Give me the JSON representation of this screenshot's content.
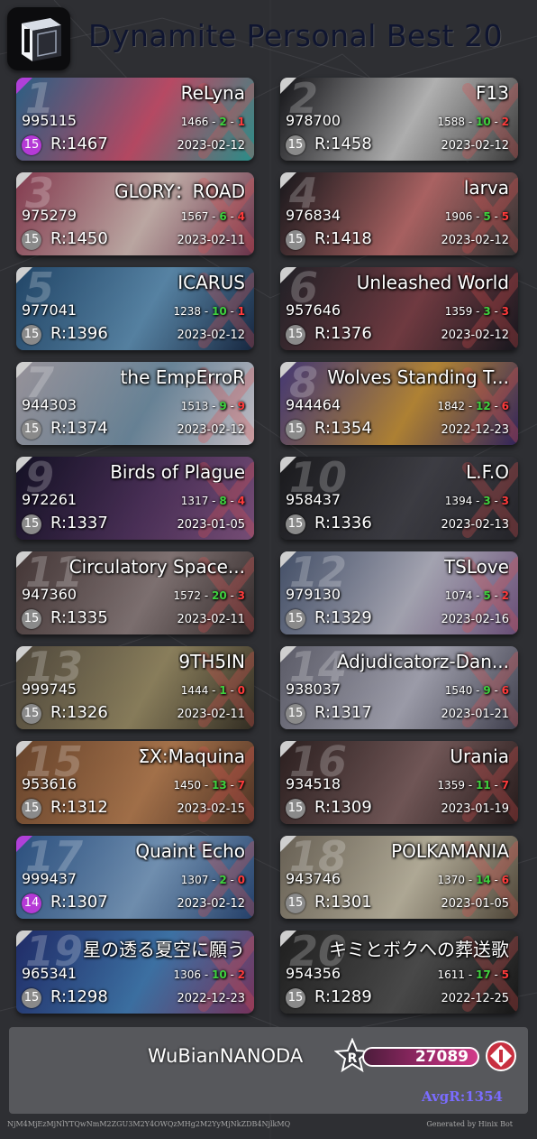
{
  "header": {
    "title": "Dynamite Personal Best 20",
    "logo_icon": "cube-logo-icon"
  },
  "cards": [
    {
      "rank": "1",
      "song": "ReLyna",
      "score": "995115",
      "notes": "1466",
      "good": "2",
      "miss": "1",
      "level": "15",
      "level_color": "purple",
      "rating": "R:1467",
      "date": "2023-02-12",
      "art": [
        "#3a7fb0",
        "#e05a7a",
        "#2fa6a0"
      ],
      "corner": "purple"
    },
    {
      "rank": "2",
      "song": "F13",
      "score": "978700",
      "notes": "1588",
      "good": "10",
      "miss": "2",
      "level": "15",
      "level_color": "gray",
      "rating": "R:1458",
      "date": "2023-02-12",
      "art": [
        "#1a1a1f",
        "#d8d8d8",
        "#444"
      ],
      "corner": "gray"
    },
    {
      "rank": "3",
      "song": "GLORY：ROAD",
      "score": "975279",
      "notes": "1567",
      "good": "6",
      "miss": "4",
      "level": "15",
      "level_color": "gray",
      "rating": "R:1450",
      "date": "2023-02-11",
      "art": [
        "#b04f6a",
        "#e8cfc9",
        "#7a3a55"
      ],
      "corner": "gray"
    },
    {
      "rank": "4",
      "song": "larva",
      "score": "976834",
      "notes": "1906",
      "good": "5",
      "miss": "5",
      "level": "15",
      "level_color": "gray",
      "rating": "R:1418",
      "date": "2023-02-12",
      "art": [
        "#1f1f24",
        "#d07878",
        "#3a3a3a"
      ],
      "corner": "gray"
    },
    {
      "rank": "5",
      "song": "ICARUS",
      "score": "977041",
      "notes": "1238",
      "good": "10",
      "miss": "1",
      "level": "15",
      "level_color": "gray",
      "rating": "R:1396",
      "date": "2023-02-12",
      "art": [
        "#2d5d8a",
        "#6aa0c8",
        "#1a2d4a"
      ],
      "corner": "gray"
    },
    {
      "rank": "6",
      "song": "Unleashed World",
      "score": "957646",
      "notes": "1359",
      "good": "3",
      "miss": "3",
      "level": "15",
      "level_color": "gray",
      "rating": "R:1376",
      "date": "2023-02-12",
      "art": [
        "#2b2b33",
        "#8a4850",
        "#1a1a22"
      ],
      "corner": "gray"
    },
    {
      "rank": "7",
      "song": "the EmpErroR",
      "score": "944303",
      "notes": "1513",
      "good": "9",
      "miss": "9",
      "level": "15",
      "level_color": "gray",
      "rating": "R:1374",
      "date": "2023-02-12",
      "art": [
        "#c9c3cd",
        "#7fa0b8",
        "#e3dce4"
      ],
      "corner": "gray"
    },
    {
      "rank": "8",
      "song": "Wolves Standing T...",
      "score": "944464",
      "notes": "1842",
      "good": "12",
      "miss": "6",
      "level": "15",
      "level_color": "gray",
      "rating": "R:1354",
      "date": "2022-12-23",
      "art": [
        "#5a4a9a",
        "#d8a040",
        "#3a2a6a"
      ],
      "corner": "gray"
    },
    {
      "rank": "9",
      "song": "Birds of Plague",
      "score": "972261",
      "notes": "1317",
      "good": "8",
      "miss": "4",
      "level": "15",
      "level_color": "gray",
      "rating": "R:1337",
      "date": "2023-01-05",
      "art": [
        "#1a1630",
        "#5a3a6a",
        "#8a5a8a"
      ],
      "corner": "gray"
    },
    {
      "rank": "10",
      "song": "L.F.O",
      "score": "958437",
      "notes": "1394",
      "good": "3",
      "miss": "3",
      "level": "15",
      "level_color": "gray",
      "rating": "R:1336",
      "date": "2023-02-13",
      "art": [
        "#232327",
        "#4a4a52",
        "#2a2a30"
      ],
      "corner": "gray"
    },
    {
      "rank": "11",
      "song": "Circulatory Space...",
      "score": "947360",
      "notes": "1572",
      "good": "20",
      "miss": "3",
      "level": "15",
      "level_color": "gray",
      "rating": "R:1335",
      "date": "2023-02-11",
      "art": [
        "#5a4848",
        "#9a8a8a",
        "#3a3030"
      ],
      "corner": "gray"
    },
    {
      "rank": "12",
      "song": "TSLove",
      "score": "979130",
      "notes": "1074",
      "good": "5",
      "miss": "2",
      "level": "15",
      "level_color": "gray",
      "rating": "R:1329",
      "date": "2023-02-16",
      "art": [
        "#5a6a8a",
        "#c8c8d8",
        "#7a5a8a"
      ],
      "corner": "gray"
    },
    {
      "rank": "13",
      "song": "9TH5IN",
      "score": "999745",
      "notes": "1444",
      "good": "1",
      "miss": "0",
      "level": "15",
      "level_color": "gray",
      "rating": "R:1326",
      "date": "2023-02-11",
      "art": [
        "#6a6050",
        "#a89a70",
        "#3a3428"
      ],
      "corner": "gray"
    },
    {
      "rank": "14",
      "song": "Adjudicatorz-Dan...",
      "score": "938037",
      "notes": "1540",
      "good": "9",
      "miss": "6",
      "level": "15",
      "level_color": "gray",
      "rating": "R:1317",
      "date": "2023-01-21",
      "art": [
        "#7a7a8a",
        "#c0c0d0",
        "#4a4a5a"
      ],
      "corner": "gray"
    },
    {
      "rank": "15",
      "song": "ΣX:Maquina",
      "score": "953616",
      "notes": "1450",
      "good": "13",
      "miss": "7",
      "level": "15",
      "level_color": "gray",
      "rating": "R:1312",
      "date": "2023-02-15",
      "art": [
        "#8a5a3a",
        "#c88a5a",
        "#5a3a2a"
      ],
      "corner": "gray"
    },
    {
      "rank": "16",
      "song": "Urania",
      "score": "934518",
      "notes": "1359",
      "good": "11",
      "miss": "7",
      "level": "15",
      "level_color": "gray",
      "rating": "R:1309",
      "date": "2023-01-19",
      "art": [
        "#3a2a2a",
        "#8a6a6a",
        "#2a1e1e"
      ],
      "corner": "gray"
    },
    {
      "rank": "17",
      "song": "Quaint Echo",
      "score": "999437",
      "notes": "1307",
      "good": "2",
      "miss": "0",
      "level": "14",
      "level_color": "purple",
      "rating": "R:1307",
      "date": "2023-02-12",
      "art": [
        "#3a6aa8",
        "#8ab0d8",
        "#2a4a7a"
      ],
      "corner": "purple"
    },
    {
      "rank": "18",
      "song": "POLKAMANIA",
      "score": "943746",
      "notes": "1370",
      "good": "14",
      "miss": "6",
      "level": "15",
      "level_color": "gray",
      "rating": "R:1301",
      "date": "2023-01-05",
      "art": [
        "#8a8070",
        "#d8d0b8",
        "#5a5040"
      ],
      "corner": "gray"
    },
    {
      "rank": "19",
      "song": "星の透る夏空に願う",
      "score": "965341",
      "notes": "1306",
      "good": "10",
      "miss": "2",
      "level": "15",
      "level_color": "gray",
      "rating": "R:1298",
      "date": "2022-12-23",
      "art": [
        "#2a3a8a",
        "#4a8ac8",
        "#8a3a6a"
      ],
      "corner": "gray"
    },
    {
      "rank": "20",
      "song": "キミとボクへの葬送歌",
      "score": "954356",
      "notes": "1611",
      "good": "17",
      "miss": "5",
      "level": "15",
      "level_color": "gray",
      "rating": "R:1289",
      "date": "2022-12-25",
      "art": [
        "#2a2a2a",
        "#5a5a5a",
        "#1a1a1a"
      ],
      "corner": "gray"
    }
  ],
  "footer": {
    "player_name": "WuBianNANODA",
    "rating_icon": "r-star-icon",
    "total_rating": "27089",
    "rank_icon": "rank-badge-icon",
    "avg_rating": "AvgR:1354"
  },
  "hash": "NjM4MjEzMjNlYTQwNmM2ZGU3M2Y4OWQzMHg2M2YyMjNkZDB4NjlkMQ",
  "generator": "Generated by Hinix Bot",
  "colors": {
    "background": "#2e2f33",
    "title": "#0f1530",
    "good": "#3fd13f",
    "miss": "#ff3b3b",
    "level_purple": "#b53ad6",
    "level_gray": "#8a8a8a",
    "avg": "#7a6cff"
  }
}
